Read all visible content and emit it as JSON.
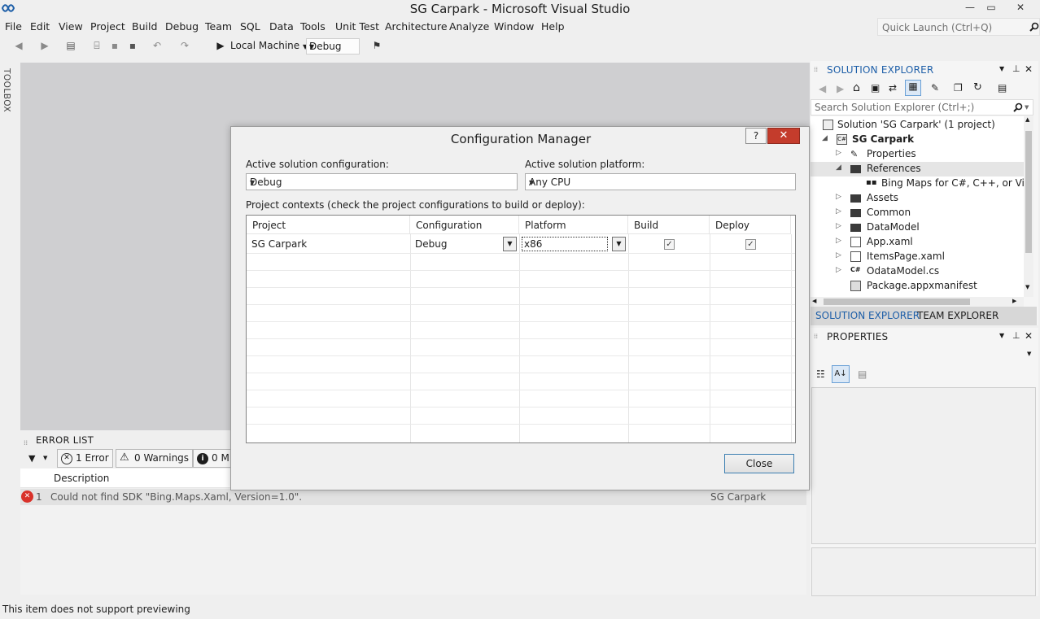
{
  "window": {
    "title": "SG Carpark - Microsoft Visual Studio",
    "minimize": "—",
    "restore": "▭",
    "close": "✕"
  },
  "menu": [
    "File",
    "Edit",
    "View",
    "Project",
    "Build",
    "Debug",
    "Team",
    "SQL",
    "Data",
    "Tools",
    "Unit Test",
    "Architecture",
    "Analyze",
    "Window",
    "Help"
  ],
  "quick_launch": {
    "placeholder": "Quick Launch (Ctrl+Q)"
  },
  "toolbar": {
    "run_target": "Local Machine",
    "configuration": "Debug"
  },
  "toolbox": {
    "label": "TOOLBOX"
  },
  "error_list": {
    "title": "ERROR LIST",
    "errors_btn": "1 Error",
    "warnings_btn": "0 Warnings",
    "messages_btn": "0 M",
    "col_description": "Description",
    "rows": [
      {
        "num": "1",
        "description": "Could not find SDK \"Bing.Maps.Xaml, Version=1.0\".",
        "project": "SG Carpark"
      }
    ]
  },
  "status_bar": {
    "text": "This item does not support previewing"
  },
  "solution_explorer": {
    "title": "SOLUTION EXPLORER",
    "search_placeholder": "Search Solution Explorer (Ctrl+;)",
    "items": [
      {
        "label": "Solution 'SG Carpark' (1 project)",
        "icon": "solution-icon"
      },
      {
        "label": "SG Carpark",
        "icon": "csharp-project-icon"
      },
      {
        "label": "Properties",
        "icon": "wrench-icon"
      },
      {
        "label": "References",
        "icon": "folder-icon"
      },
      {
        "label": "Bing Maps for C#, C++, or Visual",
        "icon": "reference-icon"
      },
      {
        "label": "Assets",
        "icon": "folder-icon"
      },
      {
        "label": "Common",
        "icon": "folder-icon"
      },
      {
        "label": "DataModel",
        "icon": "folder-icon"
      },
      {
        "label": "App.xaml",
        "icon": "xaml-icon"
      },
      {
        "label": "ItemsPage.xaml",
        "icon": "xaml-icon"
      },
      {
        "label": "OdataModel.cs",
        "icon": "csharp-file-icon"
      },
      {
        "label": "Package.appxmanifest",
        "icon": "manifest-icon"
      }
    ],
    "tabs": [
      "SOLUTION EXPLORER",
      "TEAM EXPLORER"
    ]
  },
  "properties": {
    "title": "PROPERTIES"
  },
  "config_manager": {
    "title": "Configuration Manager",
    "help": "?",
    "close_x": "✕",
    "active_config_label": "Active solution configuration:",
    "active_config_value": "Debug",
    "active_platform_label": "Active solution platform:",
    "active_platform_value": "Any CPU",
    "contexts_label": "Project contexts (check the project configurations to build or deploy):",
    "columns": [
      "Project",
      "Configuration",
      "Platform",
      "Build",
      "Deploy"
    ],
    "rows": [
      {
        "project": "SG Carpark",
        "configuration": "Debug",
        "platform": "x86",
        "build": "✓",
        "deploy": "✓"
      }
    ],
    "close_button": "Close"
  }
}
